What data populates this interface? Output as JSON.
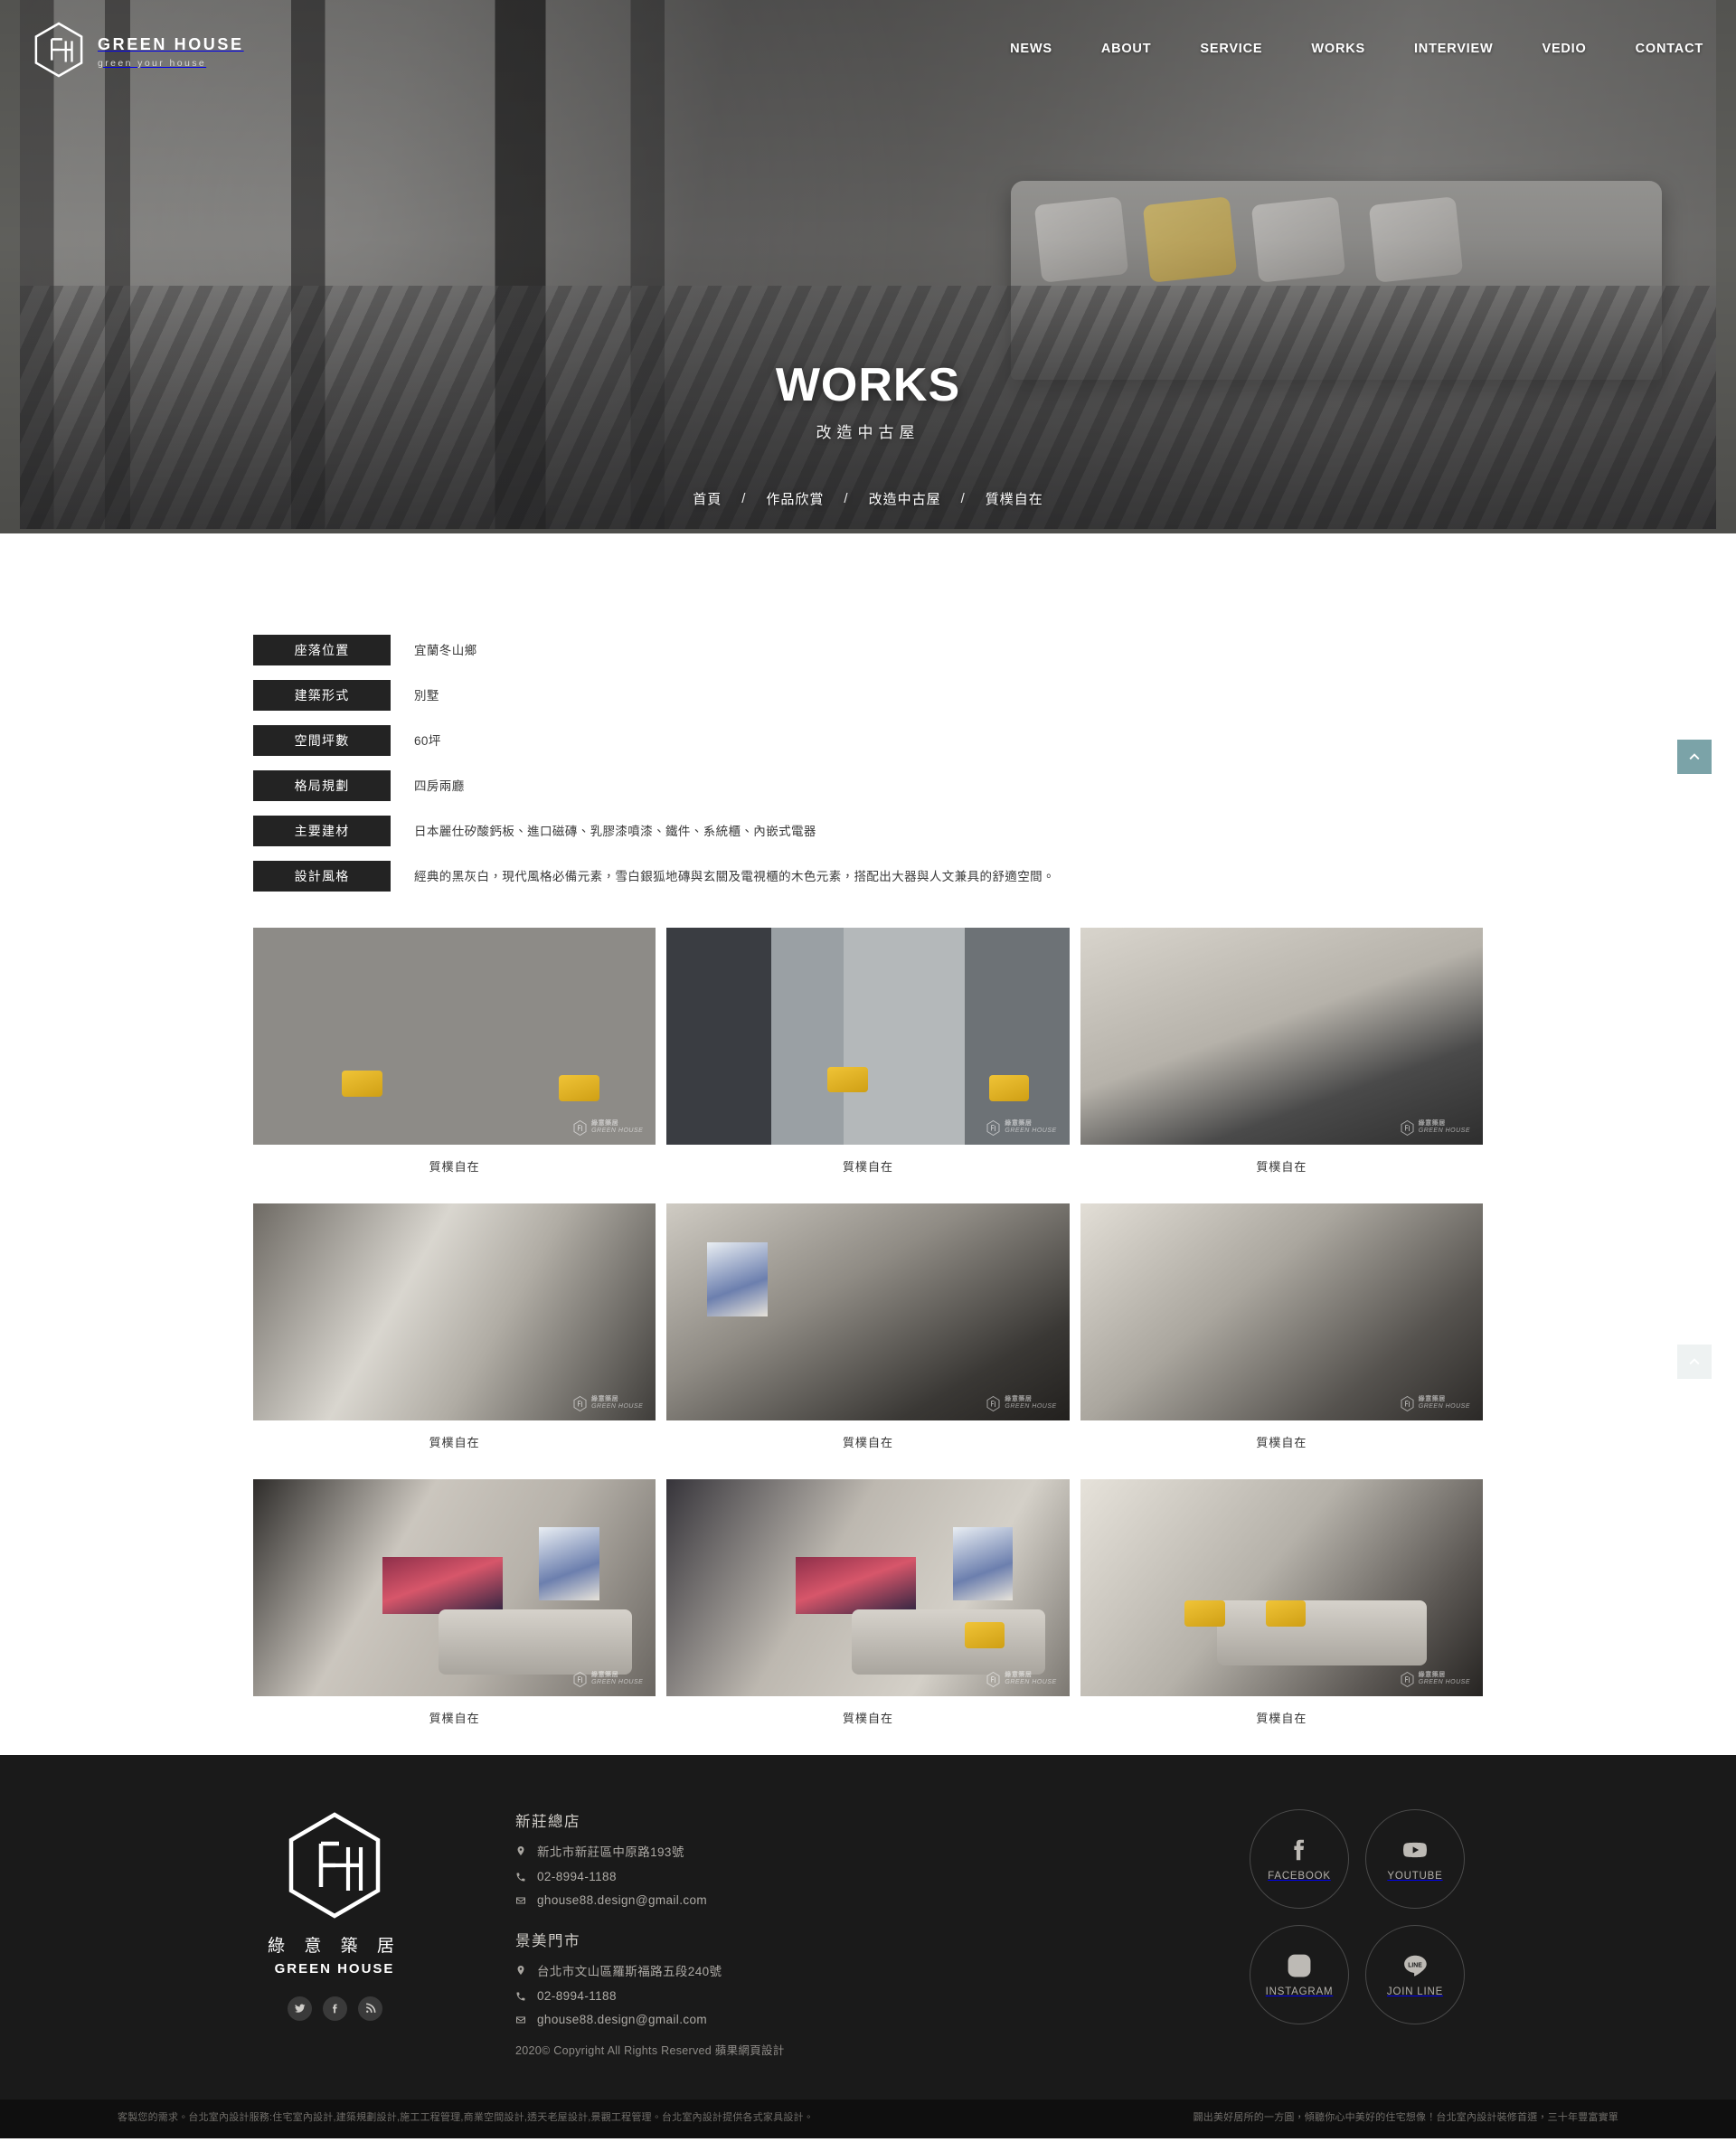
{
  "site": {
    "logo_title": "GREEN HOUSE",
    "logo_sub": "green your house",
    "footer_logo_cn": "綠 意 築 居",
    "footer_logo_en": "GREEN HOUSE"
  },
  "nav": {
    "items": [
      {
        "label": "NEWS"
      },
      {
        "label": "ABOUT"
      },
      {
        "label": "SERVICE"
      },
      {
        "label": "WORKS"
      },
      {
        "label": "INTERVIEW"
      },
      {
        "label": "VEDIO"
      },
      {
        "label": "CONTACT"
      }
    ]
  },
  "hero": {
    "title": "WORKS",
    "subtitle": "改造中古屋",
    "breadcrumb": [
      {
        "label": "首頁"
      },
      {
        "label": "作品欣賞"
      },
      {
        "label": "改造中古屋"
      },
      {
        "label": "質樸自在"
      }
    ],
    "separator": "/"
  },
  "spec": {
    "rows": [
      {
        "label": "座落位置",
        "value": "宜蘭冬山鄉"
      },
      {
        "label": "建築形式",
        "value": "別墅"
      },
      {
        "label": "空間坪數",
        "value": "60坪"
      },
      {
        "label": "格局規劃",
        "value": "四房兩廳"
      },
      {
        "label": "主要建材",
        "value": "日本麗仕矽酸鈣板、進口磁磚、乳膠漆噴漆、鐵件、系統櫃、內嵌式電器"
      },
      {
        "label": "設計風格",
        "value": "經典的黑灰白，現代風格必備元素，雪白銀狐地磚與玄關及電視櫃的木色元素，搭配出大器與人文兼具的舒適空間。"
      }
    ]
  },
  "gallery": {
    "watermark_cn": "綠意築居",
    "watermark_en": "GREEN HOUSE",
    "items": [
      {
        "caption": "質樸自在"
      },
      {
        "caption": "質樸自在"
      },
      {
        "caption": "質樸自在"
      },
      {
        "caption": "質樸自在"
      },
      {
        "caption": "質樸自在"
      },
      {
        "caption": "質樸自在"
      },
      {
        "caption": "質樸自在"
      },
      {
        "caption": "質樸自在"
      },
      {
        "caption": "質樸自在"
      }
    ]
  },
  "float_buttons": {
    "scroll_top_label": "",
    "scroll_top_label_2": ""
  },
  "footer": {
    "branches": [
      {
        "title": "新莊總店",
        "address": "新北市新莊區中原路193號",
        "phone": "02-8994-1188",
        "email": "ghouse88.design@gmail.com"
      },
      {
        "title": "景美門市",
        "address": "台北市文山區羅斯福路五段240號",
        "phone": "02-8994-1188",
        "email": "ghouse88.design@gmail.com"
      }
    ],
    "copyright": "2020© Copyright All Rights Reserved  蘋果網頁設計",
    "social_small": [
      {
        "name": "twitter"
      },
      {
        "name": "facebook"
      },
      {
        "name": "rss"
      }
    ],
    "social": [
      {
        "label": "FACEBOOK"
      },
      {
        "label": "YOUTUBE"
      },
      {
        "label": "INSTAGRAM"
      },
      {
        "label": "JOIN LINE"
      }
    ],
    "seo_left": "客製您的需求。台北室內設計服務:住宅室內設計,建築規劃設計,施工工程管理,商業空間設計,透天老屋設計,景觀工程管理。台北室內設計提供各式家具設計。",
    "seo_right": "闢出美好居所的一方圓，傾聽你心中美好的住宅想像！台北室內設計裝修首選，三十年豐富實單"
  },
  "colors": {
    "accent_teal": "#7ba3a8",
    "label_dark": "#232323",
    "footer_bg": "#1a1a1a",
    "seo_bg": "#0f0f0f"
  }
}
